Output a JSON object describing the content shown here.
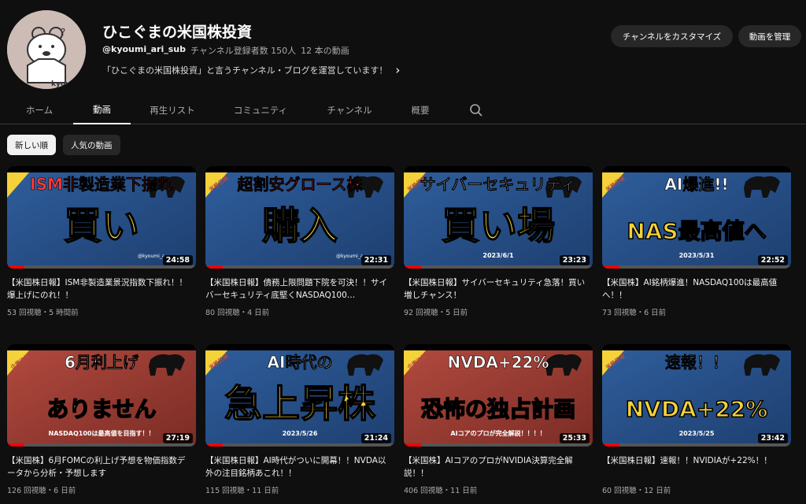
{
  "channel": {
    "name": "ひこぐまの米国株投資",
    "handle": "@kyoumi_ari_sub",
    "subscribers": "チャンネル登録者数 150人",
    "video_count": "12 本の動画",
    "description": "「ひこぐまの米国株投資」と言うチャンネル・ブログを運営しています！",
    "avatar_text": "kyoumi"
  },
  "buttons": {
    "customize": "チャンネルをカスタマイズ",
    "manage": "動画を管理"
  },
  "tabs": [
    {
      "label": "ホーム"
    },
    {
      "label": "動画"
    },
    {
      "label": "再生リスト"
    },
    {
      "label": "コミュニティ"
    },
    {
      "label": "チャンネル"
    },
    {
      "label": "概要"
    }
  ],
  "chips": [
    {
      "label": "新しい順"
    },
    {
      "label": "人気の動画"
    }
  ],
  "videos": [
    {
      "title": "【米国株日報】ISM非製造業景況指数下振れ！！爆上げにのれ！！",
      "meta": "53 回視聴・5 時間前",
      "duration": "24:58",
      "thumb": {
        "top": "ISM非製造業下振れ",
        "big": "買い",
        "date": "",
        "badge": "",
        "small": "@kyoumi_a"
      }
    },
    {
      "title": "【米国株日報】債務上限問題下院を可決！！サイバーセキュリティ底堅くNASDAQ100…",
      "meta": "80 回視聴・4 日前",
      "duration": "22:31",
      "thumb": {
        "top": "超割安グロース株",
        "big": "購入",
        "date": "",
        "badge": "米株日報",
        "small": "@kyoumi_a"
      }
    },
    {
      "title": "【米国株日報】サイバーセキュリティ急落！買い増しチャンス！",
      "meta": "92 回視聴・5 日前",
      "duration": "23:23",
      "thumb": {
        "top": "サイバーセキュリティ",
        "big": "買い場",
        "date": "2023/6/1",
        "badge": "米株日報",
        "small": ""
      }
    },
    {
      "title": "【米国株】AI銘柄爆進！NASDAQ100は最高値へ！！",
      "meta": "73 回視聴・6 日前",
      "duration": "22:52",
      "thumb": {
        "top": "AI爆進!!",
        "big": "NAS最高値へ",
        "date": "2023/5/31",
        "badge": "米株日報",
        "small": ""
      }
    },
    {
      "title": "【米国株】6月FOMCの利上げ予想を物価指数データから分析・予想します",
      "meta": "126 回視聴・6 日前",
      "duration": "27:19",
      "thumb": {
        "top": "6月利上げ",
        "big": "ありません",
        "date": "NASDAQ100は最高値を目指す！！",
        "badge": "企業決算",
        "small": ""
      }
    },
    {
      "title": "【米国株日報】AI時代がついに開幕！！NVDA以外の注目銘柄あこれ！！",
      "meta": "115 回視聴・11 日前",
      "duration": "21:24",
      "thumb": {
        "top": "AI時代の",
        "big": "急上昇株",
        "date": "2023/5/26",
        "badge": "米株日報",
        "small": ""
      }
    },
    {
      "title": "【米国株】AIコアのプロがNVIDIA決算完全解説！！",
      "meta": "406 回視聴・11 日前",
      "duration": "25:33",
      "thumb": {
        "top": "NVDA+22%",
        "big": "恐怖の独占計画",
        "date": "AIコアのプロが完全解説！！！！",
        "badge": "企業決算",
        "small": ""
      }
    },
    {
      "title": "【米国株日報】速報！！NVIDIAが+22%！！",
      "meta": "60 回視聴・12 日前",
      "duration": "23:42",
      "thumb": {
        "top": "速報！！",
        "big": "NVDA+22%",
        "date": "2023/5/25",
        "badge": "米株日報",
        "small": ""
      }
    }
  ],
  "colors": {
    "background": "#0f0f0f",
    "thumb_blue": "#2f5e9c",
    "thumb_red": "#b34a3f",
    "thumb_yellow": "#f5d13a",
    "progress_red": "#ff0000"
  }
}
